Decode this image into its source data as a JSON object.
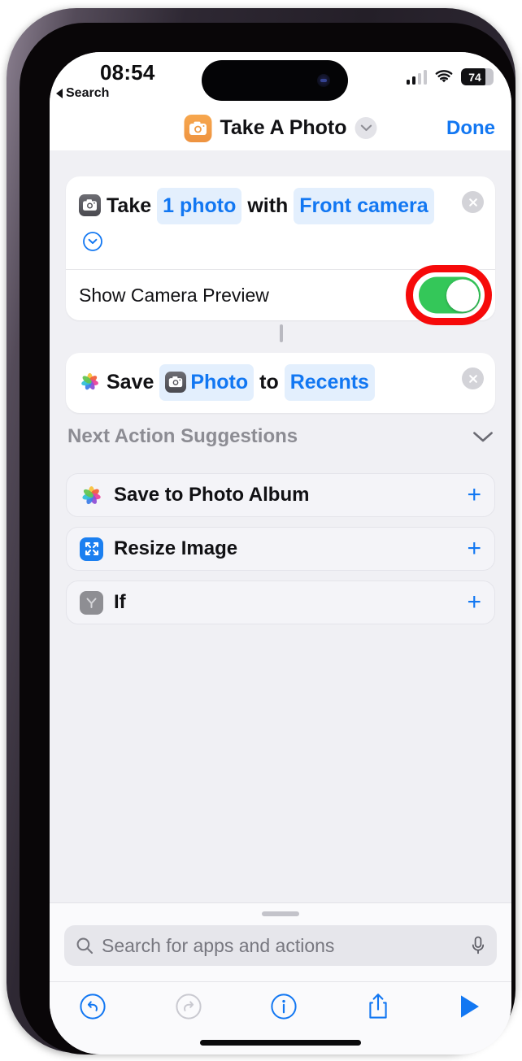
{
  "status_bar": {
    "time": "08:54",
    "back_label": "Search",
    "battery_percent": "74",
    "signal_icon": "cellular-signal-icon",
    "wifi_icon": "wifi-icon",
    "battery_icon": "battery-icon"
  },
  "nav": {
    "app_icon": "camera-app-icon",
    "title": "Take A Photo",
    "chevron_icon": "chevron-down-icon",
    "done_label": "Done"
  },
  "actions": [
    {
      "icon": "camera-icon",
      "text_parts": [
        {
          "type": "plain",
          "text": "Take"
        },
        {
          "type": "pill",
          "text": "1 photo"
        },
        {
          "type": "plain",
          "text": "with"
        },
        {
          "type": "pill",
          "text": "Front camera"
        }
      ],
      "inline_chevron_icon": "chevron-down-circle-icon",
      "remove_icon": "close-circle-icon",
      "toggle": {
        "label": "Show Camera Preview",
        "state": "on",
        "color": "#34c759",
        "annotated": true,
        "annotation_color": "#f60a0a"
      }
    },
    {
      "icon": "photos-app-icon",
      "text_parts": [
        {
          "type": "plain",
          "text": "Save"
        },
        {
          "type": "pill-with-icon",
          "text": "Photo",
          "icon": "camera-icon"
        },
        {
          "type": "plain",
          "text": "to"
        },
        {
          "type": "pill",
          "text": "Recents"
        }
      ],
      "remove_icon": "close-circle-icon"
    }
  ],
  "suggestions": {
    "header": "Next Action Suggestions",
    "collapse_icon": "chevron-down-icon",
    "items": [
      {
        "label": "Save to Photo Album",
        "icon": "photos-app-icon",
        "add_label": "+"
      },
      {
        "label": "Resize Image",
        "icon": "resize-image-icon",
        "add_label": "+"
      },
      {
        "label": "If",
        "icon": "if-condition-icon",
        "add_label": "+"
      }
    ]
  },
  "sheet": {
    "search_placeholder": "Search for apps and actions",
    "search_value": "",
    "search_icon": "search-icon",
    "mic_icon": "microphone-icon"
  },
  "toolbar": {
    "items": [
      {
        "name": "undo-button",
        "icon": "undo-icon",
        "enabled": true
      },
      {
        "name": "redo-button",
        "icon": "redo-icon",
        "enabled": false
      },
      {
        "name": "info-button",
        "icon": "info-icon",
        "enabled": true
      },
      {
        "name": "share-button",
        "icon": "share-icon",
        "enabled": true
      },
      {
        "name": "run-button",
        "icon": "play-icon",
        "enabled": true
      }
    ]
  },
  "colors": {
    "accent_blue": "#1277f2",
    "toggle_green": "#34c759",
    "annotation_red": "#f60a0a",
    "app_orange": "#f09a43"
  }
}
